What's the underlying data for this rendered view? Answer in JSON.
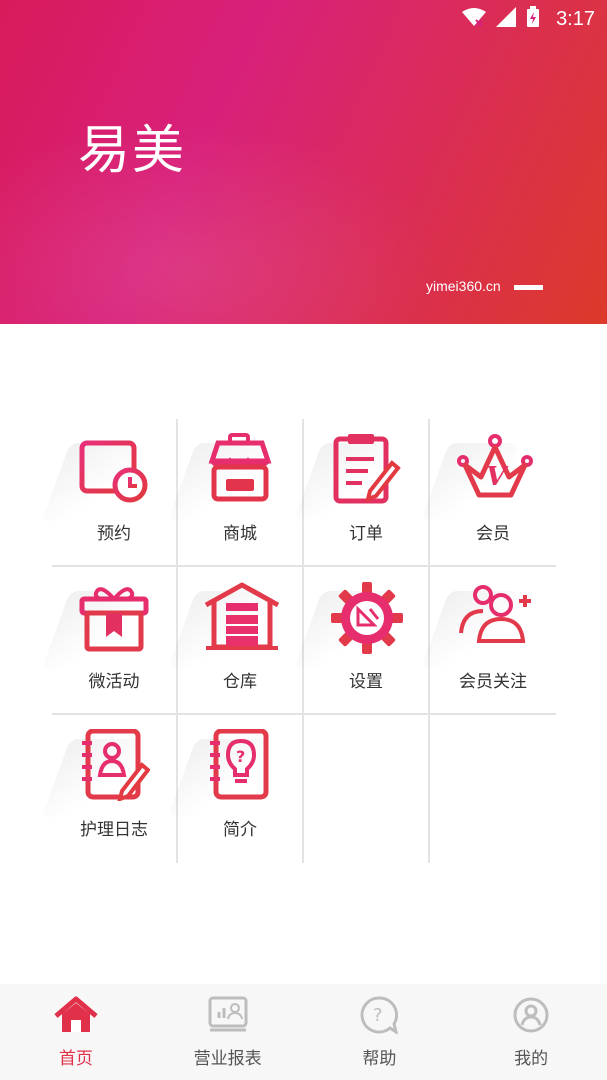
{
  "status": {
    "time": "3:17"
  },
  "hero": {
    "title": "易美",
    "url": "yimei360.cn"
  },
  "accent_color": "#e0304a",
  "grid": [
    {
      "label": "预约",
      "icon": "calendar-clock-icon"
    },
    {
      "label": "商城",
      "icon": "shop-icon"
    },
    {
      "label": "订单",
      "icon": "clipboard-order-icon"
    },
    {
      "label": "会员",
      "icon": "crown-vip-icon"
    },
    {
      "label": "微活动",
      "icon": "gift-icon"
    },
    {
      "label": "仓库",
      "icon": "warehouse-icon"
    },
    {
      "label": "设置",
      "icon": "gear-icon"
    },
    {
      "label": "会员关注",
      "icon": "users-add-icon"
    },
    {
      "label": "护理日志",
      "icon": "notebook-user-icon"
    },
    {
      "label": "简介",
      "icon": "notebook-bulb-icon"
    }
  ],
  "tabs": [
    {
      "label": "首页",
      "icon": "home-icon",
      "active": true
    },
    {
      "label": "营业报表",
      "icon": "report-icon",
      "active": false
    },
    {
      "label": "帮助",
      "icon": "help-icon",
      "active": false
    },
    {
      "label": "我的",
      "icon": "profile-icon",
      "active": false
    }
  ]
}
